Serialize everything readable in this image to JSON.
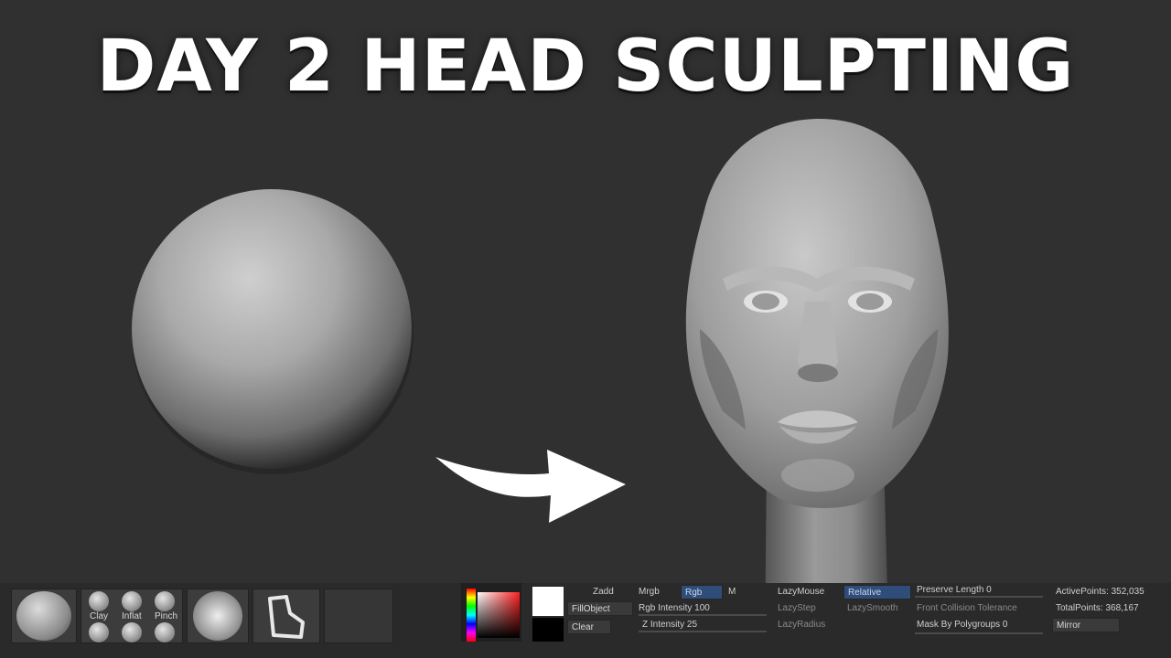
{
  "title": "DAY 2 HEAD SCULPTING",
  "brushes": [
    "Clay",
    "Inflat",
    "Pinch"
  ],
  "panel": {
    "zadd": "Zadd",
    "mrgb": "Mrgb",
    "rgb": "Rgb",
    "m": "M",
    "fill_object": "FillObject",
    "clear": "Clear",
    "rgb_intensity": "Rgb Intensity 100",
    "z_intensity": "Z Intensity 25",
    "lazy_mouse": "LazyMouse",
    "relative": "Relative",
    "lazy_step": "LazyStep",
    "lazy_smooth": "LazySmooth",
    "lazy_radius": "LazyRadius",
    "preserve_length": "Preserve Length 0",
    "front_collision": "Front Collision Tolerance",
    "mask_polygroups": "Mask By Polygroups 0",
    "active_points": "ActivePoints: 352,035",
    "total_points": "TotalPoints: 368,167",
    "mirror": "Mirror"
  },
  "colors": {
    "background": "#303030",
    "accent_active": "#2f4d78"
  }
}
